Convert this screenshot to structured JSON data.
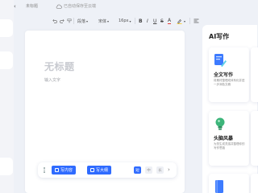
{
  "topbar": {
    "doc_title": "未标题",
    "save_status": "已自动保存至云端"
  },
  "toolbar": {
    "paragraph_label": "段落",
    "font_label": "宋体",
    "size_label": "16px"
  },
  "document": {
    "title_placeholder": "无标题",
    "body_placeholder": "输入文字"
  },
  "bottom_bar": {
    "primary_button": "写内容",
    "secondary_button": "写大纲",
    "mode_options": [
      "短",
      "中",
      "长"
    ]
  },
  "ai_panel": {
    "title": "AI写作",
    "cards": [
      {
        "title": "全文写作",
        "desc": "将素材整理成体系化并进一步润色文稿"
      },
      {
        "title": "头脑风暴",
        "desc": "为您生成灵感并整理你的写作思路"
      }
    ]
  },
  "colors": {
    "accent": "#2f6bff",
    "background": "#eef1f7"
  }
}
